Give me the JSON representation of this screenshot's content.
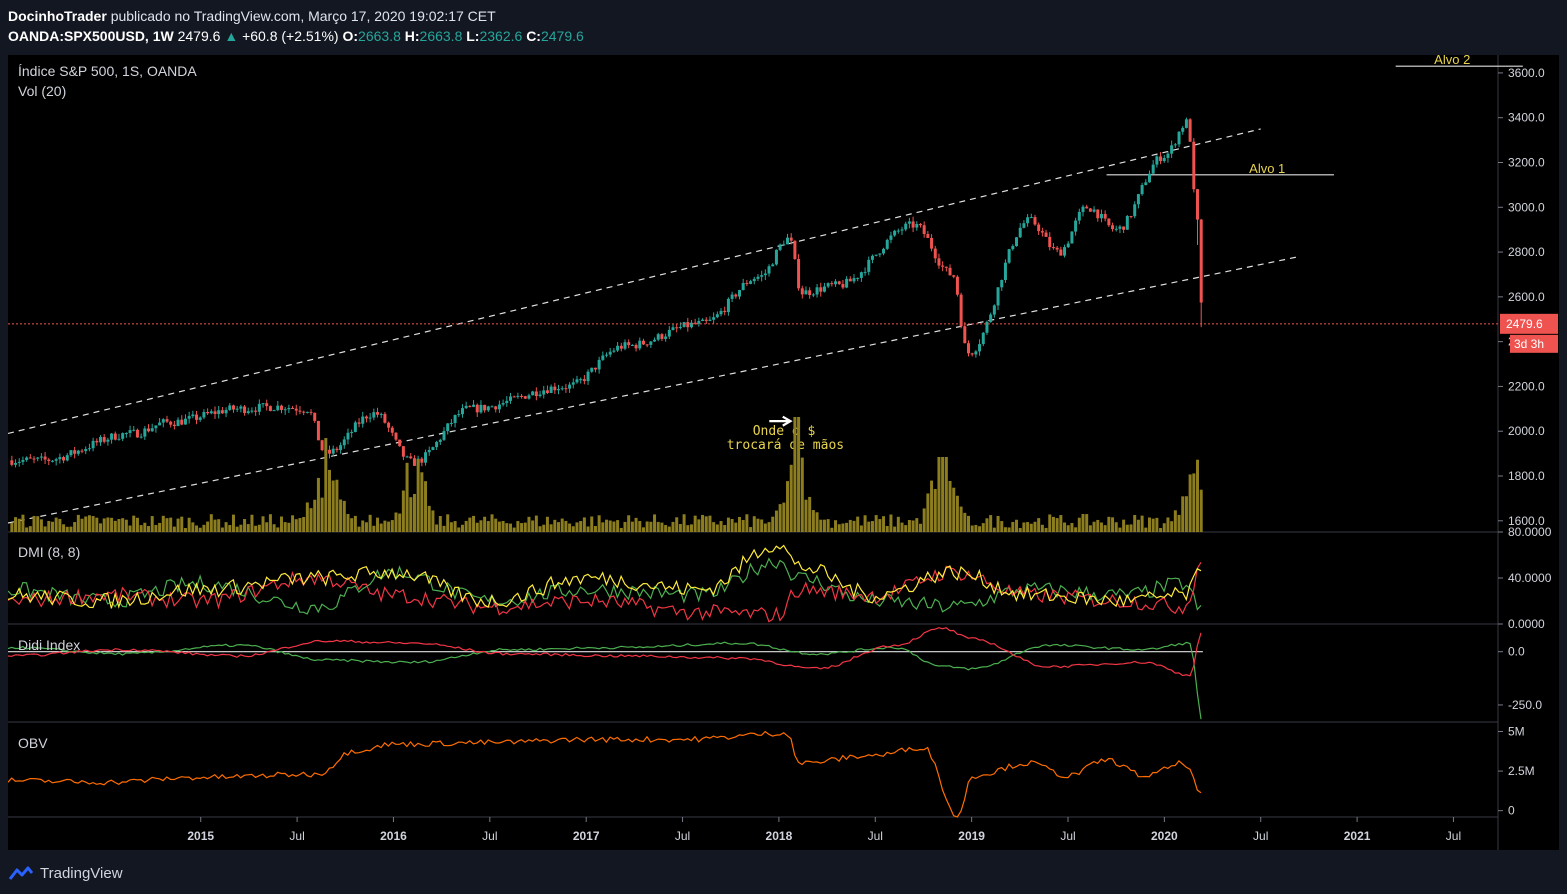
{
  "header": {
    "author": "DocinhoTrader",
    "published": "publicado no TradingView.com, Março 17, 2020 19:02:17 CET",
    "symbol": "OANDA:SPX500USD, 1W",
    "last": "2479.6",
    "change": "+60.8 (+2.51%)",
    "o_label": "O:",
    "o_val": "2663.8",
    "h_label": "H:",
    "h_val": "2663.8",
    "l_label": "L:",
    "l_val": "2362.6",
    "c_label": "C:",
    "c_val": "2479.6"
  },
  "panes": {
    "main_title": "Índice S&P 500, 1S, OANDA",
    "vol_title": "Vol (20)",
    "dmi_title": "DMI (8, 8)",
    "didi_title": "Didi Index",
    "obv_title": "OBV"
  },
  "annotations": {
    "alvo1": "Alvo 1",
    "alvo2": "Alvo 2",
    "note_line1": "Onde o $",
    "note_line2": "trocará de mãos"
  },
  "price_tag": {
    "value": "2479.6",
    "countdown": "3d 3h"
  },
  "footer": {
    "brand": "TradingView"
  },
  "colors": {
    "up": "#26a69a",
    "down": "#ef5350",
    "volume": "#8c7d1e",
    "dmi_plus": "#4caf50",
    "dmi_minus": "#f23645",
    "adx": "#ffeb3b",
    "obv": "#ff6d00",
    "annotation": "#e8d44d"
  },
  "chart_data": [
    {
      "type": "candlestick",
      "title": "Índice S&P 500, 1S, OANDA",
      "ylim": [
        1550,
        3680
      ],
      "y_ticks": [
        "3600.0",
        "3400.0",
        "3200.0",
        "3000.0",
        "2800.0",
        "2600.0",
        "2400.0",
        "2200.0",
        "2000.0",
        "1800.0",
        "1600.0"
      ],
      "x_ticks": [
        "2015",
        "Jul",
        "2016",
        "Jul",
        "2017",
        "Jul",
        "2018",
        "Jul",
        "2019",
        "Jul",
        "2020",
        "Jul",
        "2021",
        "Jul"
      ],
      "anchors": {
        "x": [
          2014.17,
          2014.65,
          2014.83,
          2015.2,
          2015.4,
          2015.55,
          2015.65,
          2015.9,
          2016.1,
          2016.4,
          2016.9,
          2017.2,
          2017.6,
          2017.9,
          2018.05,
          2018.12,
          2018.3,
          2018.7,
          2018.9,
          2018.98,
          2019.3,
          2019.45,
          2019.6,
          2019.75,
          2020.0,
          2020.12,
          2020.17,
          2020.2
        ],
        "y": [
          1870,
          1990,
          2040,
          2100,
          2110,
          2100,
          1900,
          2080,
          1860,
          2100,
          2200,
          2380,
          2480,
          2690,
          2860,
          2620,
          2650,
          2920,
          2700,
          2350,
          2940,
          2800,
          3000,
          2900,
          3230,
          3380,
          2950,
          2480
        ]
      },
      "last_price": 2479.6
    },
    {
      "type": "bar",
      "title": "Vol (20)",
      "note": "weekly volume histogram",
      "spikes_x": [
        2015.65,
        2016.1,
        2018.1,
        2018.85,
        2020.16
      ]
    },
    {
      "type": "line",
      "title": "DMI (8, 8)",
      "ylim": [
        0,
        80
      ],
      "y_ticks": [
        "80.0000",
        "40.0000",
        "0.0000"
      ],
      "series": [
        {
          "name": "+DI",
          "x": [
            2014.0,
            2014.5,
            2015.0,
            2015.6,
            2016.0,
            2016.5,
            2017.0,
            2017.6,
            2018.0,
            2018.1,
            2018.5,
            2018.9,
            2019.3,
            2019.8,
            2020.1,
            2020.2
          ],
          "y": [
            30,
            20,
            35,
            15,
            45,
            20,
            30,
            25,
            55,
            40,
            20,
            15,
            30,
            25,
            35,
            10
          ]
        },
        {
          "name": "-DI",
          "x": [
            2014.0,
            2014.5,
            2015.0,
            2015.6,
            2016.0,
            2016.5,
            2017.0,
            2017.6,
            2018.0,
            2018.1,
            2018.5,
            2018.9,
            2019.3,
            2019.8,
            2020.1,
            2020.2
          ],
          "y": [
            20,
            25,
            20,
            40,
            25,
            15,
            20,
            10,
            8,
            30,
            25,
            45,
            25,
            20,
            15,
            55
          ]
        },
        {
          "name": "ADX",
          "x": [
            2014.0,
            2014.5,
            2015.0,
            2015.6,
            2016.0,
            2016.5,
            2017.0,
            2017.6,
            2018.0,
            2018.1,
            2018.5,
            2018.9,
            2019.3,
            2019.8,
            2020.1,
            2020.2
          ],
          "y": [
            25,
            20,
            30,
            40,
            45,
            20,
            40,
            30,
            70,
            50,
            25,
            45,
            25,
            20,
            25,
            45
          ]
        }
      ]
    },
    {
      "type": "line",
      "title": "Didi Index",
      "ylim": [
        -330,
        130
      ],
      "y_ticks": [
        "0.0",
        "-250.0"
      ],
      "series": [
        {
          "name": "fast",
          "x": [
            2014.0,
            2014.6,
            2015.2,
            2015.65,
            2016.1,
            2016.6,
            2017.2,
            2017.8,
            2018.2,
            2018.6,
            2018.85,
            2019.0,
            2019.4,
            2019.9,
            2020.13,
            2020.2
          ],
          "y": [
            20,
            -10,
            30,
            -40,
            -50,
            10,
            20,
            40,
            -10,
            20,
            -70,
            -80,
            30,
            10,
            40,
            -330
          ]
        },
        {
          "name": "slow",
          "x": [
            2014.0,
            2014.6,
            2015.2,
            2015.65,
            2016.1,
            2016.6,
            2017.2,
            2017.8,
            2018.2,
            2018.6,
            2018.85,
            2019.0,
            2019.4,
            2019.9,
            2020.13,
            2020.2
          ],
          "y": [
            -20,
            10,
            -20,
            50,
            40,
            -10,
            -20,
            -30,
            -80,
            30,
            110,
            60,
            -70,
            -50,
            -110,
            100
          ]
        }
      ]
    },
    {
      "type": "line",
      "title": "OBV",
      "ylim": [
        -0.4,
        5.6
      ],
      "y_ticks": [
        "5M",
        "2.5M",
        "0"
      ],
      "series": [
        {
          "name": "OBV",
          "x": [
            2014.0,
            2014.5,
            2015.0,
            2015.6,
            2015.8,
            2016.0,
            2016.5,
            2017.0,
            2017.5,
            2018.05,
            2018.1,
            2018.5,
            2018.75,
            2018.93,
            2019.0,
            2019.3,
            2019.5,
            2019.7,
            2019.9,
            2020.1,
            2020.2
          ],
          "y": [
            1.9,
            1.8,
            2.1,
            2.3,
            3.8,
            4.2,
            4.3,
            4.5,
            4.5,
            4.9,
            3.0,
            3.5,
            4.0,
            -0.4,
            2.2,
            3.0,
            2.2,
            3.2,
            2.2,
            3.0,
            1.0
          ]
        }
      ]
    }
  ]
}
